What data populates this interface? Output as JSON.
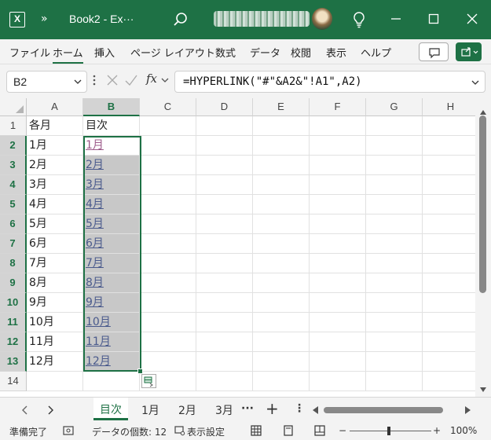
{
  "titlebar": {
    "app_logo": "X",
    "qat_more": "»",
    "doc_title": "Book2  -  Ex···",
    "icons": [
      "excel-logo-icon",
      "search-icon",
      "lightbulb-icon",
      "minimize-icon",
      "maximize-icon",
      "close-icon"
    ]
  },
  "ribbon": {
    "tabs": [
      "ファイル",
      "ホーム",
      "挿入",
      "ページ レイアウト",
      "数式",
      "データ",
      "校閲",
      "表示",
      "ヘルプ"
    ],
    "active_tab": "ホーム"
  },
  "formula_bar": {
    "name_box": "B2",
    "fx": "fx",
    "formula": "=HYPERLINK(\"#\"&A2&\"!A1\",A2)"
  },
  "grid": {
    "columns": [
      "A",
      "B",
      "C",
      "D",
      "E",
      "F",
      "G",
      "H"
    ],
    "selected_column": "B",
    "rows": [
      "1",
      "2",
      "3",
      "4",
      "5",
      "6",
      "7",
      "8",
      "9",
      "10",
      "11",
      "12",
      "13",
      "14"
    ],
    "A": [
      "各月",
      "1月",
      "2月",
      "3月",
      "4月",
      "5月",
      "6月",
      "7月",
      "8月",
      "9月",
      "10月",
      "11月",
      "12月",
      ""
    ],
    "B": [
      "目次",
      "1月",
      "2月",
      "3月",
      "4月",
      "5月",
      "6月",
      "7月",
      "8月",
      "9月",
      "10月",
      "11月",
      "12月",
      ""
    ]
  },
  "sheet_tabs": {
    "tabs": [
      "目次",
      "1月",
      "2月",
      "3月"
    ],
    "active": "目次",
    "more": "···",
    "add": "+",
    "options": "⋮"
  },
  "status_bar": {
    "ready": "準備完了",
    "count": "データの個数: 12",
    "display_settings": "表示設定",
    "zoom_minus": "−",
    "zoom_plus": "+",
    "zoom": "100%"
  },
  "colors": {
    "accent": "#1e7145",
    "link": "#4a5a8c",
    "visited_link": "#9c5a8a",
    "selection_fill": "#c8c8c8"
  }
}
